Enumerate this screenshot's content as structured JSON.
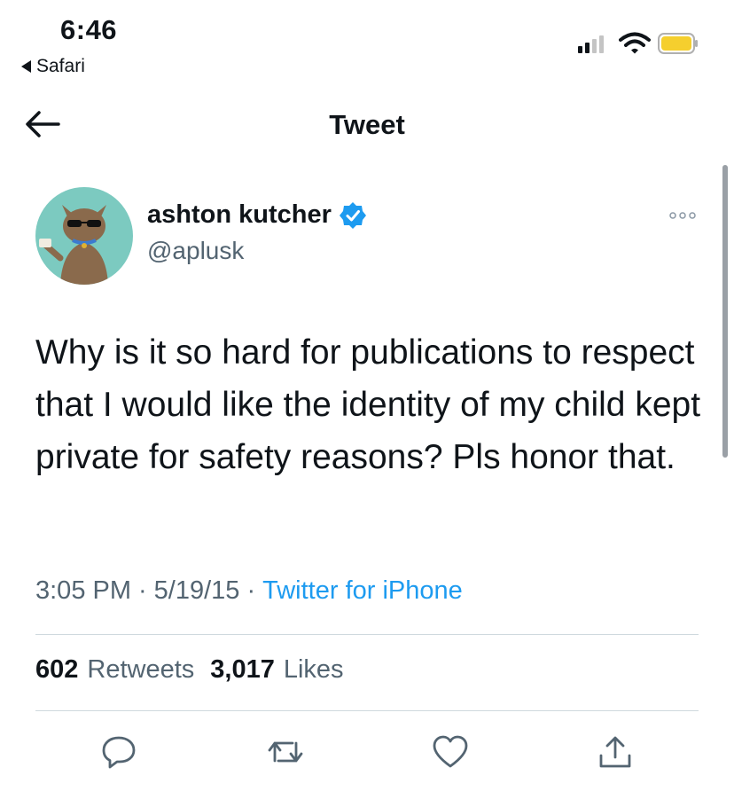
{
  "status_bar": {
    "time": "6:46",
    "back_app_label": "Safari"
  },
  "header": {
    "title": "Tweet"
  },
  "author": {
    "name": "ashton kutcher",
    "handle": "@aplusk",
    "verified": true
  },
  "tweet": {
    "text": "Why is it so hard for publications to respect that I would like the identity of my child kept private for safety reasons? Pls honor that.",
    "time": "3:05 PM",
    "date": "5/19/15",
    "source": "Twitter for iPhone",
    "separator": "·"
  },
  "stats": {
    "retweets_count": "602",
    "retweets_label": "Retweets",
    "likes_count": "3,017",
    "likes_label": "Likes"
  },
  "actions": [
    "reply-icon",
    "retweet-icon",
    "like-icon",
    "share-icon"
  ],
  "colors": {
    "accent": "#1d9bf0",
    "text": "#0f1419",
    "secondary_text": "#536471",
    "divider": "#cfd9de",
    "battery": "#f5cf2e"
  }
}
